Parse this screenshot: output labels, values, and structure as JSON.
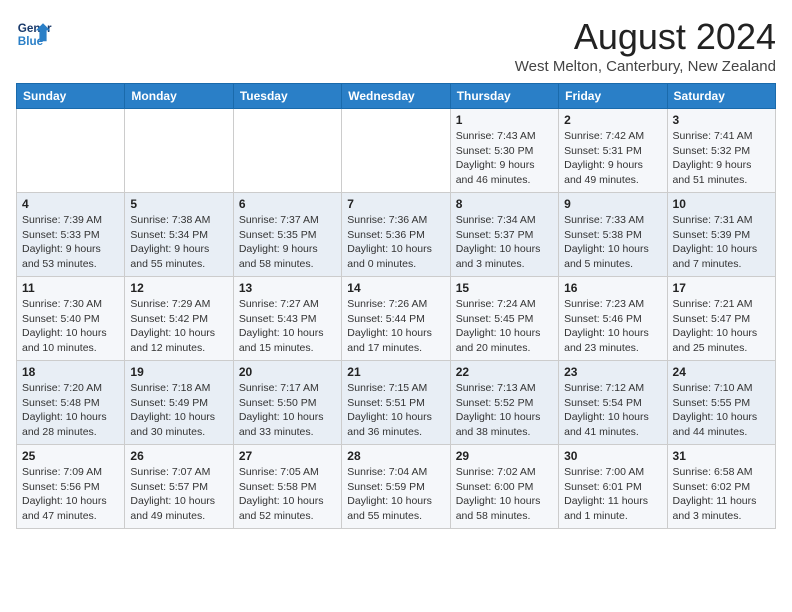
{
  "logo": {
    "line1": "General",
    "line2": "Blue"
  },
  "title": "August 2024",
  "subtitle": "West Melton, Canterbury, New Zealand",
  "days_header": [
    "Sunday",
    "Monday",
    "Tuesday",
    "Wednesday",
    "Thursday",
    "Friday",
    "Saturday"
  ],
  "weeks": [
    [
      {
        "num": "",
        "info": ""
      },
      {
        "num": "",
        "info": ""
      },
      {
        "num": "",
        "info": ""
      },
      {
        "num": "",
        "info": ""
      },
      {
        "num": "1",
        "info": "Sunrise: 7:43 AM\nSunset: 5:30 PM\nDaylight: 9 hours\nand 46 minutes."
      },
      {
        "num": "2",
        "info": "Sunrise: 7:42 AM\nSunset: 5:31 PM\nDaylight: 9 hours\nand 49 minutes."
      },
      {
        "num": "3",
        "info": "Sunrise: 7:41 AM\nSunset: 5:32 PM\nDaylight: 9 hours\nand 51 minutes."
      }
    ],
    [
      {
        "num": "4",
        "info": "Sunrise: 7:39 AM\nSunset: 5:33 PM\nDaylight: 9 hours\nand 53 minutes."
      },
      {
        "num": "5",
        "info": "Sunrise: 7:38 AM\nSunset: 5:34 PM\nDaylight: 9 hours\nand 55 minutes."
      },
      {
        "num": "6",
        "info": "Sunrise: 7:37 AM\nSunset: 5:35 PM\nDaylight: 9 hours\nand 58 minutes."
      },
      {
        "num": "7",
        "info": "Sunrise: 7:36 AM\nSunset: 5:36 PM\nDaylight: 10 hours\nand 0 minutes."
      },
      {
        "num": "8",
        "info": "Sunrise: 7:34 AM\nSunset: 5:37 PM\nDaylight: 10 hours\nand 3 minutes."
      },
      {
        "num": "9",
        "info": "Sunrise: 7:33 AM\nSunset: 5:38 PM\nDaylight: 10 hours\nand 5 minutes."
      },
      {
        "num": "10",
        "info": "Sunrise: 7:31 AM\nSunset: 5:39 PM\nDaylight: 10 hours\nand 7 minutes."
      }
    ],
    [
      {
        "num": "11",
        "info": "Sunrise: 7:30 AM\nSunset: 5:40 PM\nDaylight: 10 hours\nand 10 minutes."
      },
      {
        "num": "12",
        "info": "Sunrise: 7:29 AM\nSunset: 5:42 PM\nDaylight: 10 hours\nand 12 minutes."
      },
      {
        "num": "13",
        "info": "Sunrise: 7:27 AM\nSunset: 5:43 PM\nDaylight: 10 hours\nand 15 minutes."
      },
      {
        "num": "14",
        "info": "Sunrise: 7:26 AM\nSunset: 5:44 PM\nDaylight: 10 hours\nand 17 minutes."
      },
      {
        "num": "15",
        "info": "Sunrise: 7:24 AM\nSunset: 5:45 PM\nDaylight: 10 hours\nand 20 minutes."
      },
      {
        "num": "16",
        "info": "Sunrise: 7:23 AM\nSunset: 5:46 PM\nDaylight: 10 hours\nand 23 minutes."
      },
      {
        "num": "17",
        "info": "Sunrise: 7:21 AM\nSunset: 5:47 PM\nDaylight: 10 hours\nand 25 minutes."
      }
    ],
    [
      {
        "num": "18",
        "info": "Sunrise: 7:20 AM\nSunset: 5:48 PM\nDaylight: 10 hours\nand 28 minutes."
      },
      {
        "num": "19",
        "info": "Sunrise: 7:18 AM\nSunset: 5:49 PM\nDaylight: 10 hours\nand 30 minutes."
      },
      {
        "num": "20",
        "info": "Sunrise: 7:17 AM\nSunset: 5:50 PM\nDaylight: 10 hours\nand 33 minutes."
      },
      {
        "num": "21",
        "info": "Sunrise: 7:15 AM\nSunset: 5:51 PM\nDaylight: 10 hours\nand 36 minutes."
      },
      {
        "num": "22",
        "info": "Sunrise: 7:13 AM\nSunset: 5:52 PM\nDaylight: 10 hours\nand 38 minutes."
      },
      {
        "num": "23",
        "info": "Sunrise: 7:12 AM\nSunset: 5:54 PM\nDaylight: 10 hours\nand 41 minutes."
      },
      {
        "num": "24",
        "info": "Sunrise: 7:10 AM\nSunset: 5:55 PM\nDaylight: 10 hours\nand 44 minutes."
      }
    ],
    [
      {
        "num": "25",
        "info": "Sunrise: 7:09 AM\nSunset: 5:56 PM\nDaylight: 10 hours\nand 47 minutes."
      },
      {
        "num": "26",
        "info": "Sunrise: 7:07 AM\nSunset: 5:57 PM\nDaylight: 10 hours\nand 49 minutes."
      },
      {
        "num": "27",
        "info": "Sunrise: 7:05 AM\nSunset: 5:58 PM\nDaylight: 10 hours\nand 52 minutes."
      },
      {
        "num": "28",
        "info": "Sunrise: 7:04 AM\nSunset: 5:59 PM\nDaylight: 10 hours\nand 55 minutes."
      },
      {
        "num": "29",
        "info": "Sunrise: 7:02 AM\nSunset: 6:00 PM\nDaylight: 10 hours\nand 58 minutes."
      },
      {
        "num": "30",
        "info": "Sunrise: 7:00 AM\nSunset: 6:01 PM\nDaylight: 11 hours\nand 1 minute."
      },
      {
        "num": "31",
        "info": "Sunrise: 6:58 AM\nSunset: 6:02 PM\nDaylight: 11 hours\nand 3 minutes."
      }
    ]
  ]
}
